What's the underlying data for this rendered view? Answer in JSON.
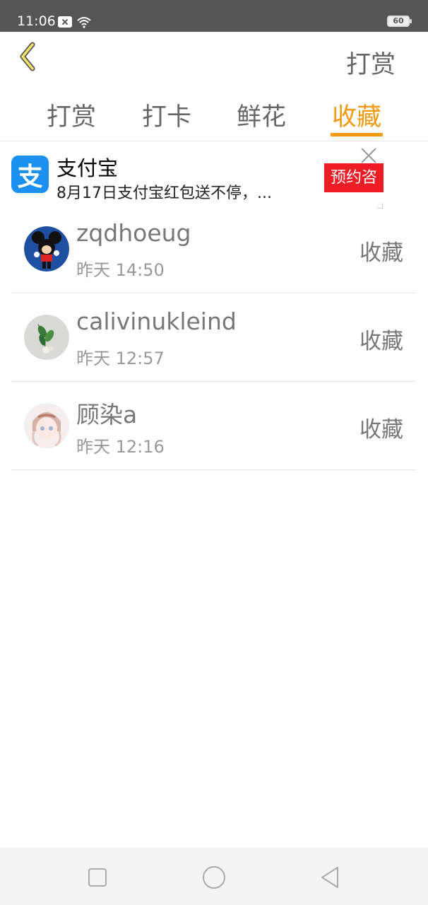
{
  "status_bar": {
    "time": "11:06",
    "battery": "60",
    "icons": [
      "notification-x-icon",
      "wifi-icon",
      "battery-icon"
    ]
  },
  "header": {
    "back_icon": "chevron-left-icon",
    "title": "打赏"
  },
  "tabs": [
    {
      "label": "打赏",
      "active": false
    },
    {
      "label": "打卡",
      "active": false
    },
    {
      "label": "鲜花",
      "active": false
    },
    {
      "label": "收藏",
      "active": true
    }
  ],
  "ad": {
    "logo_text": "支",
    "title": "支付宝",
    "description": "8月17日支付宝红包送不停，...",
    "cta": "预约咨",
    "close_icon": "close-icon"
  },
  "list": [
    {
      "name": "zqdhoeug",
      "time": "昨天 14:50",
      "action": "收藏"
    },
    {
      "name": "calivinukleind",
      "time": "昨天 12:57",
      "action": "收藏"
    },
    {
      "name": "顾染a",
      "time": "昨天 12:16",
      "action": "收藏"
    }
  ],
  "nav": {
    "icons": [
      "square-icon",
      "circle-icon",
      "triangle-back-icon"
    ]
  },
  "colors": {
    "accent": "#f29a13",
    "status_bar": "#555555",
    "ad_cta": "#ee1c24",
    "alipay_blue": "#1a90f0"
  }
}
